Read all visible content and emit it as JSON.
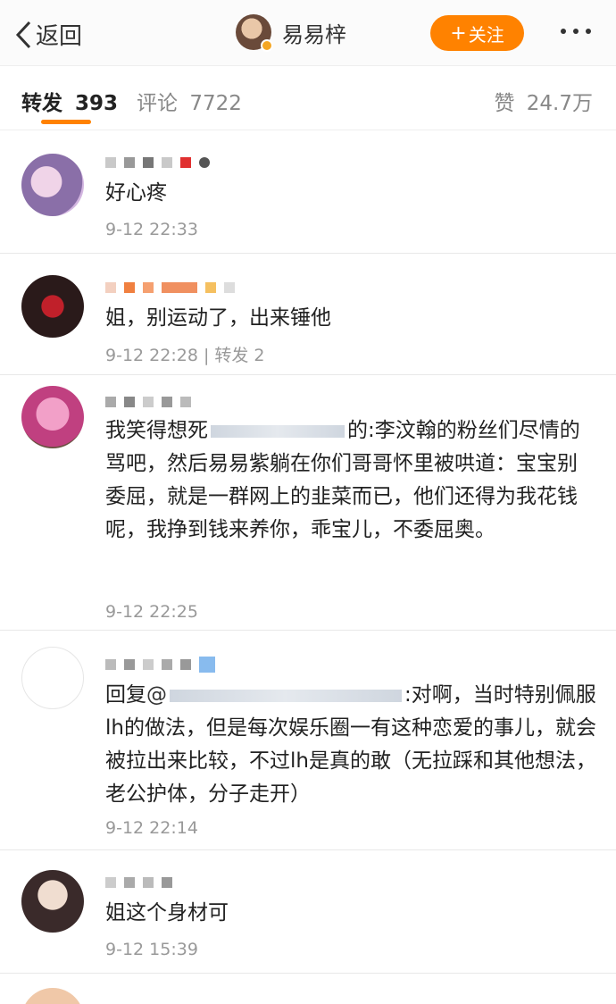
{
  "header": {
    "back_label": "返回",
    "user_name": "易易梓",
    "follow_label": "关注",
    "follow_plus": "+",
    "colors": {
      "accent": "#ff8200"
    }
  },
  "tabs": {
    "repost_label": "转发",
    "repost_count": "393",
    "comments_label": "评论",
    "comments_count": "7722",
    "likes_label": "赞",
    "likes_count": "24.7万"
  },
  "comments": [
    {
      "text": "好心疼",
      "meta": "9-12 22:33"
    },
    {
      "text": "姐，别运动了，出来锤他",
      "meta": "9-12 22:28 | 转发 2"
    },
    {
      "text_prefix": "我笑得想死",
      "text_mid": "的:",
      "text": "李汶翰的粉丝们尽情的骂吧，然后易易紫躺在你们哥哥怀里被哄道：宝宝别委屈，就是一群网上的韭菜而已，他们还得为我花钱呢，我挣到钱来养你，乖宝儿，不委屈奥。",
      "meta": "9-12 22:25"
    },
    {
      "reply_prefix": "回复",
      "mention_at": "@",
      "text": ":对啊，当时特别佩服lh的做法，但是每次娱乐圈一有这种恋爱的事儿，就会被拉出来比较，不过lh是真的敢（无拉踩和其他想法，老公护体，分子走开）",
      "meta": "9-12 22:14"
    },
    {
      "text": "姐这个身材可",
      "meta": "9-12 15:39"
    }
  ]
}
